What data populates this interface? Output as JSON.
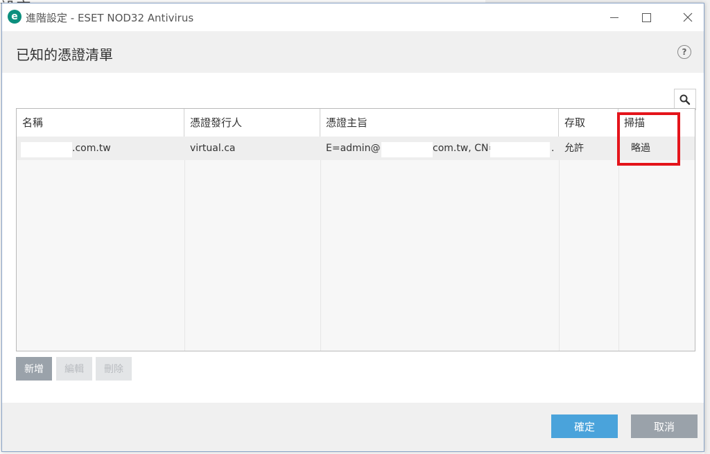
{
  "background": {
    "title_fragment": "設定"
  },
  "window": {
    "app_icon_glyph": "e",
    "title": "進階設定 - ESET NOD32 Antivirus"
  },
  "header": {
    "title": "已知的憑證清單",
    "help_glyph": "?"
  },
  "table": {
    "columns": [
      "名稱",
      "憑證發行人",
      "憑證主旨",
      "存取",
      "掃描"
    ],
    "rows": [
      {
        "name_suffix": ".com.tw",
        "issuer": "virtual.ca",
        "subject_prefix": "E=admin@",
        "subject_mid": "com.tw, CN=",
        "subject_end": ".",
        "access": "允許",
        "scan": "略過"
      }
    ]
  },
  "buttons": {
    "add": "新增",
    "edit": "編輯",
    "delete": "刪除",
    "ok": "確定",
    "cancel": "取消"
  },
  "colors": {
    "accent_blue": "#4aa3db",
    "highlight_red": "#e4141b",
    "eset_green": "#0c8f7e"
  },
  "icons": [
    "app-logo-icon",
    "minimize-icon",
    "maximize-icon",
    "close-icon",
    "help-icon",
    "search-icon"
  ]
}
